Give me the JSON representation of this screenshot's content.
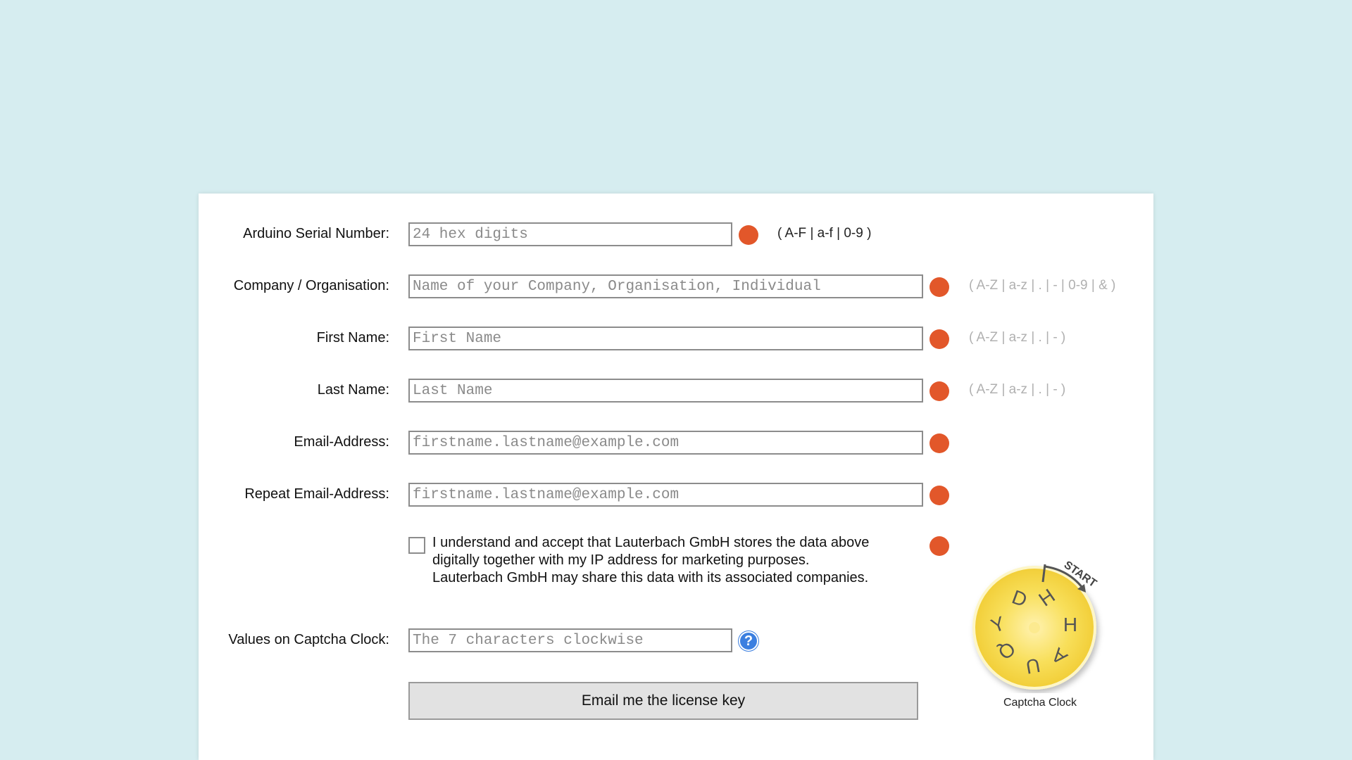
{
  "form": {
    "fields": [
      {
        "label": "Arduino Serial Number:",
        "placeholder": "24 hex digits",
        "value": "",
        "hint": "( A-F | a-f | 0-9 )"
      },
      {
        "label": "Company / Organisation:",
        "placeholder": "Name of your Company, Organisation, Individual",
        "value": "",
        "hint": "( A-Z | a-z | . | - | 0-9 | & )"
      },
      {
        "label": "First Name:",
        "placeholder": "First Name",
        "value": "",
        "hint": "( A-Z | a-z | . | - )"
      },
      {
        "label": "Last Name:",
        "placeholder": "Last Name",
        "value": "",
        "hint": "( A-Z | a-z | . | - )"
      },
      {
        "label": "Email-Address:",
        "placeholder": "firstname.lastname@example.com",
        "value": ""
      },
      {
        "label": "Repeat Email-Address:",
        "placeholder": "firstname.lastname@example.com",
        "value": ""
      }
    ],
    "consent": {
      "checked": false,
      "lines": [
        "I understand and accept that Lauterbach GmbH stores the data above",
        "digitally together with my IP address for marketing purposes.",
        "Lauterbach GmbH may share this data with its associated companies."
      ]
    },
    "captcha_field": {
      "label": "Values on Captcha Clock:",
      "placeholder": "The 7 characters clockwise",
      "value": "",
      "help_glyph": "?"
    },
    "submit_label": "Email me the license key"
  },
  "captcha_clock": {
    "start_label": "START",
    "characters": [
      "H",
      "H",
      "A",
      "U",
      "Q",
      "Y",
      "D"
    ],
    "caption": "Captcha Clock"
  },
  "colors": {
    "background": "#d6edf0",
    "required_indicator": "#e2572a",
    "help_icon": "#3b7fe0",
    "captcha_clock": "#f6d94a"
  },
  "icons": {
    "required": "required-indicator-dot",
    "help": "question-mark-icon"
  }
}
